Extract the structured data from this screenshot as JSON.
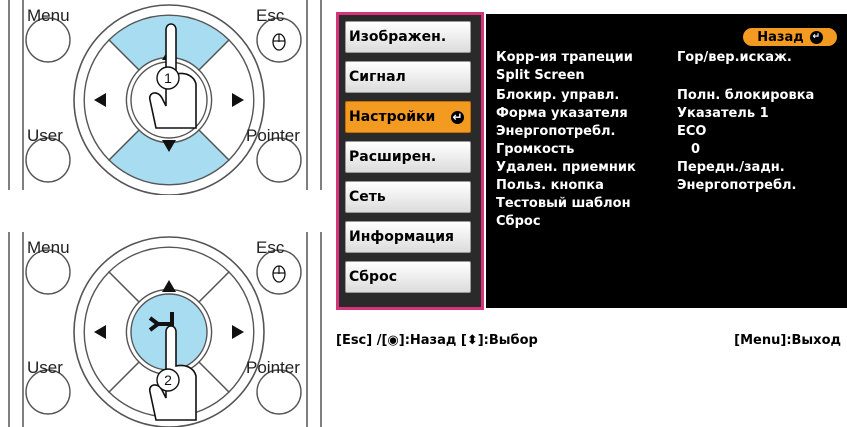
{
  "remote_top": {
    "menu_label": "Menu",
    "esc_label": "Esc",
    "user_label": "User",
    "pointer_label": "Pointer",
    "step_number": "1"
  },
  "remote_bottom": {
    "menu_label": "Menu",
    "esc_label": "Esc",
    "user_label": "User",
    "pointer_label": "Pointer",
    "step_number": "2"
  },
  "sidebar": {
    "items": [
      {
        "label": "Изображен.",
        "active": false
      },
      {
        "label": "Сигнал",
        "active": false
      },
      {
        "label": "Настройки",
        "active": true
      },
      {
        "label": "Расширен.",
        "active": false
      },
      {
        "label": "Сеть",
        "active": false
      },
      {
        "label": "Информация",
        "active": false
      },
      {
        "label": "Сброс",
        "active": false
      }
    ],
    "active_enter_icon": "enter-icon"
  },
  "main": {
    "back_label": "Назад",
    "rows": [
      {
        "key": "Корр-ия трапеции",
        "value": "Гор/вер.искаж."
      },
      {
        "key": "Split Screen",
        "value": ""
      },
      {
        "key": "Блокир. управл.",
        "value": "Полн. блокировка"
      },
      {
        "key": "Форма указателя",
        "value": "Указатель 1"
      },
      {
        "key": "Энергопотребл.",
        "value": "ECO"
      },
      {
        "key": "Громкость",
        "value": "0"
      },
      {
        "key": "Удален. приемник",
        "value": "Передн./задн."
      },
      {
        "key": "Польз. кнопка",
        "value": "Энергопотребл."
      },
      {
        "key": "Тестовый шаблон",
        "value": ""
      },
      {
        "key": "Сброс",
        "value": ""
      }
    ]
  },
  "helpbar": {
    "left": "[Esc] /[◉]:Назад  [⬍]:Выбор",
    "right": "[Menu]:Выход"
  },
  "colors": {
    "accent": "#f39a21",
    "frame": "#d4357a",
    "button_highlight": "#a8dcf0"
  }
}
